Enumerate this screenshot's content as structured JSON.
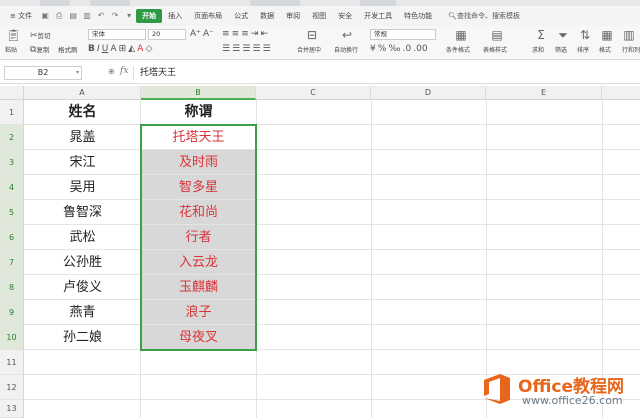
{
  "menu": {
    "file": "≡ 文件",
    "tabs": [
      "开始",
      "插入",
      "页面布局",
      "公式",
      "数据",
      "审阅",
      "视图",
      "安全",
      "开发工具",
      "特色功能"
    ],
    "active_tab": "开始",
    "search": "查找命令、搜索模板"
  },
  "ribbon": {
    "paste": "粘贴",
    "cut": "剪切",
    "copy": "复制",
    "format_painter": "格式刷",
    "font_name": "宋体",
    "font_size": "20",
    "merge_center": "合并居中",
    "wrap_text": "自动换行",
    "number_format": "常规",
    "conditional_format": "条件格式",
    "table_style": "表格样式",
    "sum": "求和",
    "filter": "筛选",
    "sort": "排序",
    "fill": "格式",
    "row_col": "行和列"
  },
  "formula_bar": {
    "name_box": "B2",
    "fx": "fx",
    "content": "托塔天王"
  },
  "columns": [
    "A",
    "B",
    "C",
    "D",
    "E"
  ],
  "rows": [
    "1",
    "2",
    "3",
    "4",
    "5",
    "6",
    "7",
    "8",
    "9",
    "10",
    "11",
    "12",
    "13"
  ],
  "table": {
    "header": [
      "姓名",
      "称谓"
    ],
    "data": [
      [
        "晁盖",
        "托塔天王"
      ],
      [
        "宋江",
        "及时雨"
      ],
      [
        "吴用",
        "智多星"
      ],
      [
        "鲁智深",
        "花和尚"
      ],
      [
        "武松",
        "行者"
      ],
      [
        "公孙胜",
        "入云龙"
      ],
      [
        "卢俊义",
        "玉麒麟"
      ],
      [
        "燕青",
        "浪子"
      ],
      [
        "孙二娘",
        "母夜叉"
      ]
    ]
  },
  "watermark": {
    "line1": "Office教程网",
    "line2": "www.office26.com"
  },
  "colors": {
    "accent": "#3aa14a",
    "red_text": "#d9343a",
    "watermark_orange": "#e8651c"
  }
}
